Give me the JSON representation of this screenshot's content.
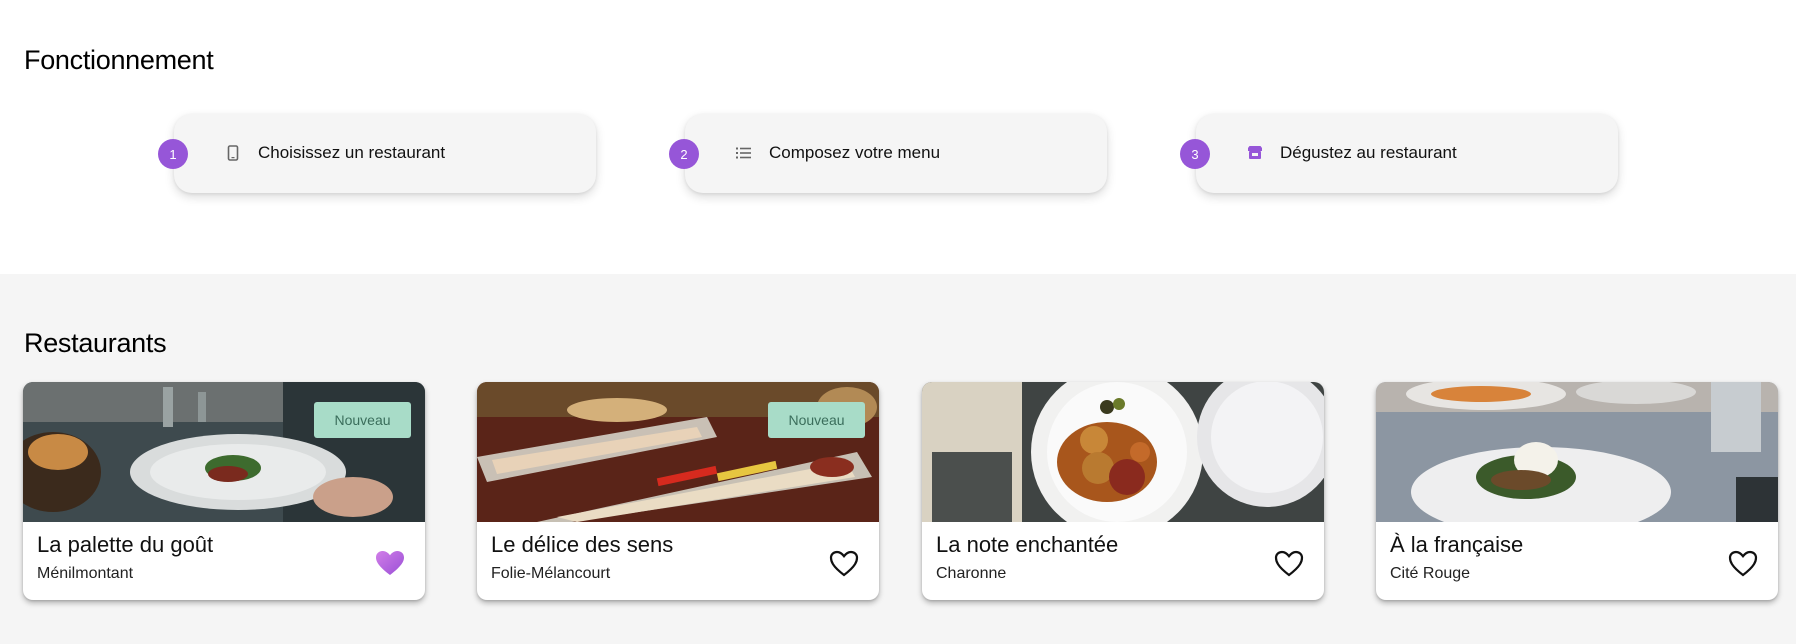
{
  "how": {
    "title": "Fonctionnement",
    "steps": [
      {
        "number": "1",
        "label": "Choisissez un restaurant",
        "icon": "phone-icon"
      },
      {
        "number": "2",
        "label": "Composez votre menu",
        "icon": "list-icon"
      },
      {
        "number": "3",
        "label": "Dégustez au restaurant",
        "icon": "store-icon"
      }
    ]
  },
  "restaurants": {
    "title": "Restaurants",
    "items": [
      {
        "name": "La palette du goût",
        "area": "Ménilmontant",
        "badge": "Nouveau",
        "favorite": true
      },
      {
        "name": "Le délice des sens",
        "area": "Folie-Mélancourt",
        "badge": "Nouveau",
        "favorite": false
      },
      {
        "name": "La note enchantée",
        "area": "Charonne",
        "badge": "",
        "favorite": false
      },
      {
        "name": "À la française",
        "area": "Cité Rouge",
        "badge": "",
        "favorite": false
      }
    ]
  },
  "colors": {
    "accent": "#9656d8",
    "badge_bg": "#a8dcc8",
    "badge_text": "#3a6d5b",
    "section_bg": "#f5f5f5"
  }
}
